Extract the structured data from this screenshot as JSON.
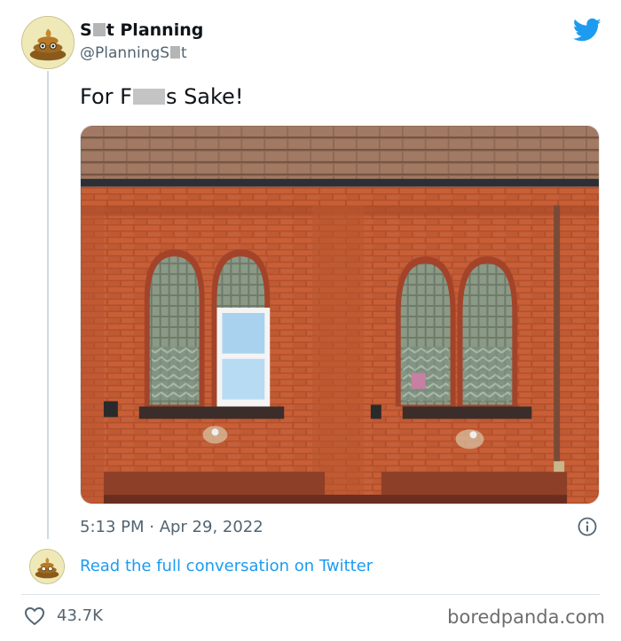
{
  "user": {
    "name_pre": "S",
    "name_post": "t Planning",
    "handle_pre": "@PlanningS",
    "handle_post": "t"
  },
  "tweet": {
    "text_pre": "For F",
    "text_post": "s Sake!",
    "timestamp": "5:13 PM · Apr 29, 2022"
  },
  "conversation_link": "Read the full conversation on Twitter",
  "likes": "43.7K",
  "source": "boredpanda.com",
  "icons": {
    "brand": "twitter-bird-icon",
    "info": "info-icon",
    "like": "heart-icon",
    "avatar": "poop-emoji-avatar"
  },
  "colors": {
    "link": "#1d9bf0",
    "twitter": "#1d9bf0",
    "text": "#0f1419",
    "muted": "#536471"
  }
}
